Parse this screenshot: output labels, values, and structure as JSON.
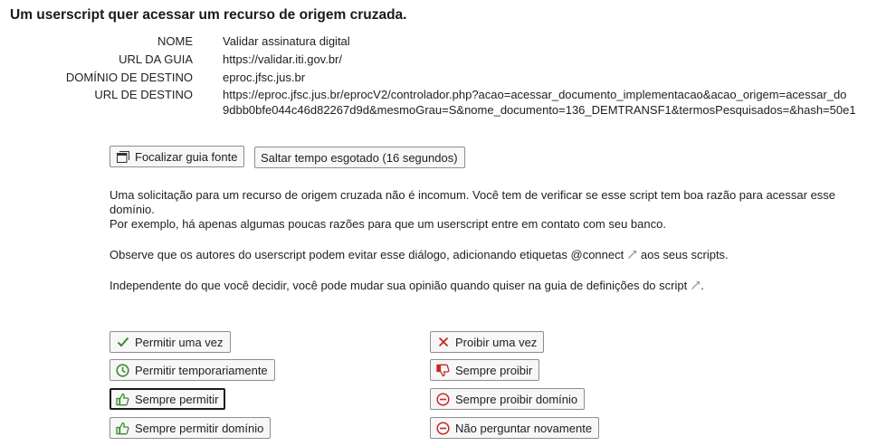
{
  "title": "Um userscript quer acessar um recurso de origem cruzada.",
  "info": [
    {
      "label": "NOME",
      "value": "Validar assinatura digital"
    },
    {
      "label": "URL DA GUIA",
      "value": "https://validar.iti.gov.br/"
    },
    {
      "label": "DOMÍNIO DE DESTINO",
      "value": "eproc.jfsc.jus.br"
    },
    {
      "label": "URL DE DESTINO",
      "value": "https://eproc.jfsc.jus.br/eprocV2/controlador.php?acao=acessar_documento_implementacao&acao_origem=acessar_do",
      "value2": "9dbb0bfe044c46d82267d9d&mesmoGrau=S&nome_documento=136_DEMTRANSF1&termosPesquisados=&hash=50e1"
    }
  ],
  "top_buttons": {
    "focus_tab": "Focalizar guia fonte",
    "skip_timeout": "Saltar tempo esgotado (16 segundos)"
  },
  "text": {
    "p1_line1": "Uma solicitação para um recurso de origem cruzada não é incomum. Você tem de verificar se esse script tem boa razão para acessar esse",
    "p1_line2": "domínio.",
    "p1_line3": "Por exemplo, há apenas algumas poucas razões para que um userscript entre em contato com seu banco.",
    "p2_before": "Observe que os autores do userscript podem evitar esse diálogo, adicionando etiquetas",
    "p2_link": "@connect",
    "p2_after": "aos seus scripts.",
    "p3_before": "Independente do que você decidir, você pode mudar sua opinião quando quiser na guia de",
    "p3_link": "definições do script",
    "p3_after": "."
  },
  "actions": {
    "allow_once": "Permitir uma vez",
    "allow_temp": "Permitir temporariamente",
    "allow_always": "Sempre permitir",
    "allow_domain": "Sempre permitir domínio",
    "deny_once": "Proibir uma vez",
    "deny_always": "Sempre proibir",
    "deny_domain": "Sempre proibir domínio",
    "never_ask": "Não perguntar novamente"
  },
  "colors": {
    "allow": "#3a8a2e",
    "deny": "#c62828"
  },
  "icons": {
    "focus_tab": "window-icon",
    "allow_once": "checkmark-icon",
    "allow_temp": "clock-icon",
    "allow_always": "thumbs-up-icon",
    "allow_domain": "thumbs-up-icon",
    "deny_once": "x-icon",
    "deny_always": "thumbs-down-icon",
    "deny_domain": "minus-circle-icon",
    "never_ask": "minus-circle-icon",
    "external_link": "external-link-icon"
  }
}
